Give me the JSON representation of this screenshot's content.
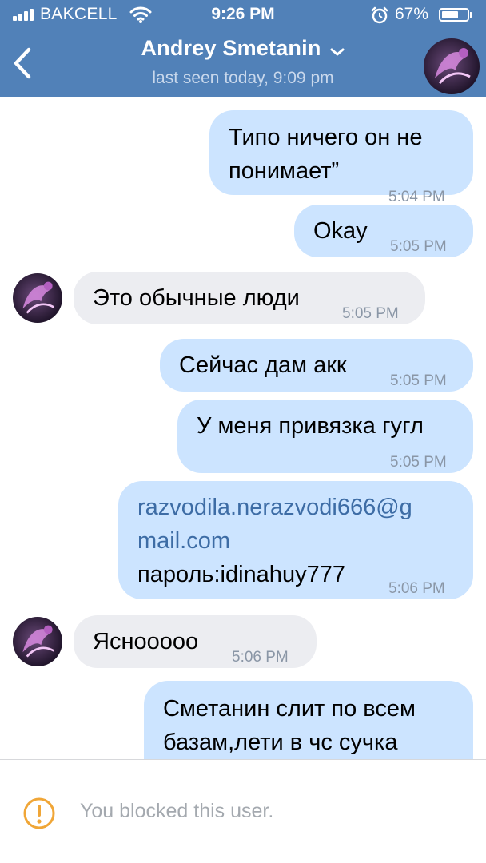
{
  "status_bar": {
    "carrier": "BAKCELL",
    "time": "9:26 PM",
    "battery": "67%",
    "battery_level": 0.67
  },
  "nav": {
    "back_icon": "chevron-left-icon",
    "title": "Andrey Smetanin",
    "title_icon": "chevron-down-icon",
    "subtitle": "last seen today, 9:09 pm"
  },
  "messages": [
    {
      "dir": "out",
      "text": "Типо ничего он не\nпонимает”",
      "time": "5:04 PM"
    },
    {
      "dir": "out",
      "text": "Okay",
      "time": "5:05 PM"
    },
    {
      "dir": "in",
      "text": "Это обычные люди",
      "time": "5:05 PM"
    },
    {
      "dir": "out",
      "text": "Сейчас дам акк",
      "time": "5:05 PM"
    },
    {
      "dir": "out",
      "text": "У меня привязка гугл",
      "time": "5:05 PM"
    },
    {
      "dir": "out",
      "link": "razvodila.nerazvodi666@g\nmail.com",
      "text": "пароль:idinahuy777",
      "time": "5:06 PM"
    },
    {
      "dir": "in",
      "text": "Ясноoooo",
      "time": "5:06 PM"
    },
    {
      "dir": "out",
      "text": "Сметанин слит по всем\nбазам,лети в чс сучка",
      "time": ""
    }
  ],
  "footer": {
    "icon": "warning-circle-icon",
    "notice": "You blocked this user."
  },
  "colors": {
    "header": "#5181b8",
    "outgoing_bubble": "#cce4ff",
    "incoming_bubble": "#ecedf1",
    "link": "#3d6ca5",
    "warning": "#f0a637"
  }
}
